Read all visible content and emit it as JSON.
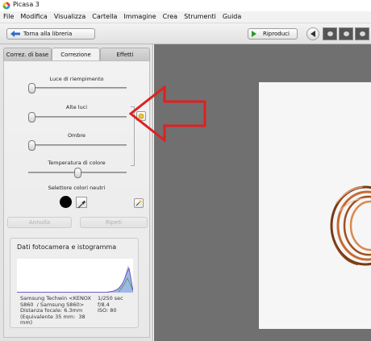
{
  "window": {
    "title": "Picasa 3"
  },
  "menu": [
    "File",
    "Modifica",
    "Visualizza",
    "Cartella",
    "Immagine",
    "Crea",
    "Strumenti",
    "Guida"
  ],
  "toolbar": {
    "back_label": "Torna alla libreria",
    "play_label": "Riproduci"
  },
  "tabs": {
    "basic": "Correz. di base",
    "correction": "Correzione",
    "effects": "Effetti"
  },
  "correction": {
    "fill_light": "Luce di riempimento",
    "highlights": "Alte luci",
    "shadows": "Ombre",
    "color_temp": "Temperatura di colore",
    "neutral_picker": "Selettore colori neutri",
    "undo": "Annulla",
    "redo": "Ripeti",
    "values": {
      "fill_light": 0.0,
      "highlights": 0.0,
      "shadows": 0.0,
      "color_temp": 0.5
    }
  },
  "camera_info": {
    "title": "Dati fotocamera e istogramma",
    "line1_left": "Samsung Techwin <KENOX",
    "line2_left": "S860  / Samsung S860>",
    "line3_left": "Distanza focale: 6.3mm",
    "line4_left": "(Equivalente 35 mm:  38",
    "line5_left": "mm)",
    "line1_right": "1/250 sec",
    "line2_right": "f/8.4",
    "line3_right": "ISO: 80"
  },
  "colors": {
    "panel_bg": "#e3e3e3",
    "viewer_bg": "#707070",
    "arrow_red": "#e02020",
    "photo_copper": "#b8602a"
  }
}
